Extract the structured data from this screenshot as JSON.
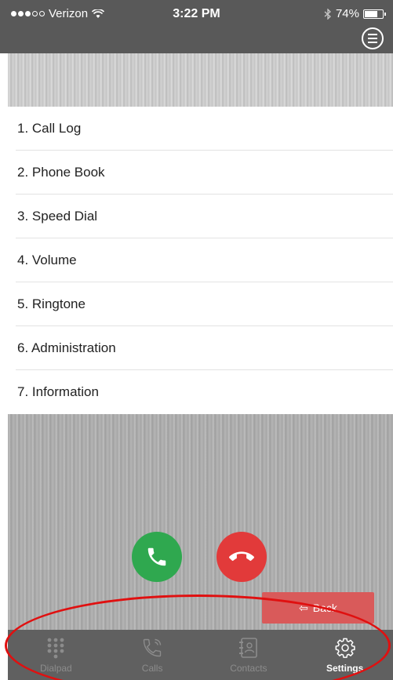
{
  "status_bar": {
    "carrier": "Verizon",
    "time": "3:22 PM",
    "battery": "74%",
    "battery_level": 0.74
  },
  "menu": {
    "items": [
      {
        "label": "1. Call Log"
      },
      {
        "label": "2. Phone Book"
      },
      {
        "label": "3. Speed Dial"
      },
      {
        "label": "4. Volume"
      },
      {
        "label": "5. Ringtone"
      },
      {
        "label": "6. Administration"
      },
      {
        "label": "7. Information"
      }
    ]
  },
  "controls": {
    "back_label": "Back"
  },
  "tabs": [
    {
      "label": "Dialpad",
      "icon": "dialpad-icon",
      "active": false
    },
    {
      "label": "Calls",
      "icon": "phone-calls-icon",
      "active": false
    },
    {
      "label": "Contacts",
      "icon": "contacts-book-icon",
      "active": false
    },
    {
      "label": "Settings",
      "icon": "gear-icon",
      "active": true
    }
  ],
  "colors": {
    "header": "#595959",
    "answer": "#2fa84f",
    "hangup": "#e23a3a",
    "back": "#d95a5a",
    "tab_bar": "#606060",
    "annotation": "#e01010"
  }
}
